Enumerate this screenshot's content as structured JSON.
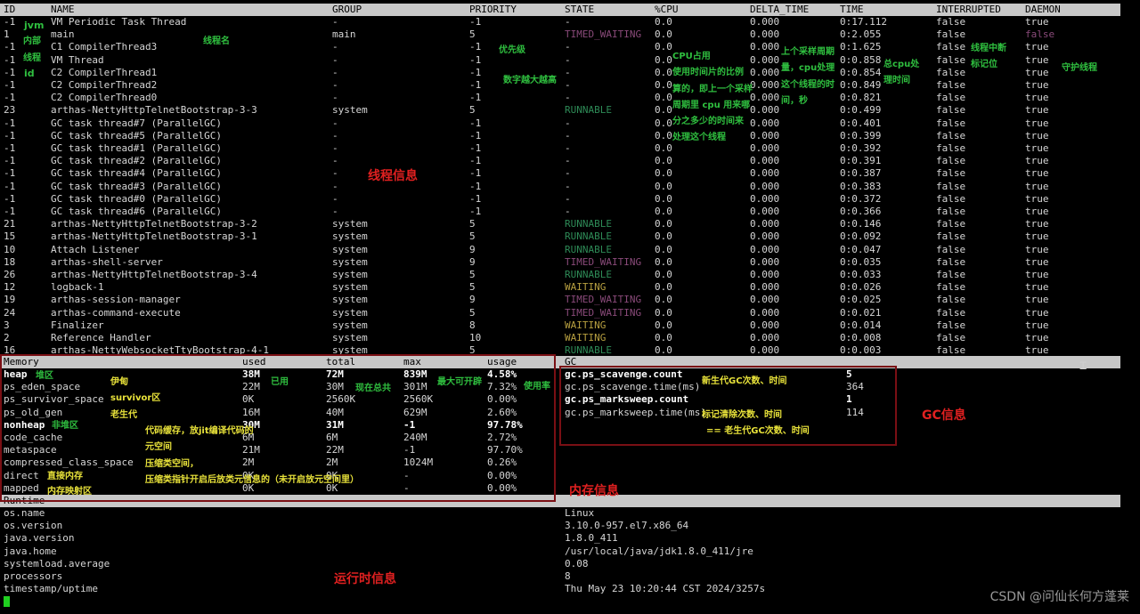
{
  "threads": {
    "headers": [
      "ID",
      "NAME",
      "GROUP",
      "PRIORITY",
      "STATE",
      "%CPU",
      "DELTA_TIME",
      "TIME",
      "INTERRUPTED",
      "DAEMON"
    ],
    "rows": [
      [
        "-1",
        "VM Periodic Task Thread",
        "-",
        "-1",
        "-",
        "0.0",
        "0.000",
        "0:17.112",
        "false",
        "true"
      ],
      [
        "1",
        "main",
        "main",
        "5",
        "TIMED_WAITING",
        "0.0",
        "0.000",
        "0:2.055",
        "false",
        "false"
      ],
      [
        "-1",
        "C1 CompilerThread3",
        "-",
        "-1",
        "-",
        "0.0",
        "0.000",
        "0:1.625",
        "false",
        "true"
      ],
      [
        "-1",
        "VM Thread",
        "-",
        "-1",
        "-",
        "0.0",
        "0.000",
        "0:0.858",
        "false",
        "true"
      ],
      [
        "-1",
        "C2 CompilerThread1",
        "-",
        "-1",
        "-",
        "0.0",
        "0.000",
        "0:0.854",
        "false",
        "true"
      ],
      [
        "-1",
        "C2 CompilerThread2",
        "-",
        "-1",
        "-",
        "0.0",
        "0.000",
        "0:0.849",
        "false",
        "true"
      ],
      [
        "-1",
        "C2 CompilerThread0",
        "-",
        "-1",
        "-",
        "0.0",
        "0.000",
        "0:0.821",
        "false",
        "true"
      ],
      [
        "23",
        "arthas-NettyHttpTelnetBootstrap-3-3",
        "system",
        "5",
        "RUNNABLE",
        "0.0",
        "0.000",
        "0:0.499",
        "false",
        "true"
      ],
      [
        "-1",
        "GC task thread#7 (ParallelGC)",
        "-",
        "-1",
        "-",
        "0.0",
        "0.000",
        "0:0.401",
        "false",
        "true"
      ],
      [
        "-1",
        "GC task thread#5 (ParallelGC)",
        "-",
        "-1",
        "-",
        "0.0",
        "0.000",
        "0:0.399",
        "false",
        "true"
      ],
      [
        "-1",
        "GC task thread#1 (ParallelGC)",
        "-",
        "-1",
        "-",
        "0.0",
        "0.000",
        "0:0.392",
        "false",
        "true"
      ],
      [
        "-1",
        "GC task thread#2 (ParallelGC)",
        "-",
        "-1",
        "-",
        "0.0",
        "0.000",
        "0:0.391",
        "false",
        "true"
      ],
      [
        "-1",
        "GC task thread#4 (ParallelGC)",
        "-",
        "-1",
        "-",
        "0.0",
        "0.000",
        "0:0.387",
        "false",
        "true"
      ],
      [
        "-1",
        "GC task thread#3 (ParallelGC)",
        "-",
        "-1",
        "-",
        "0.0",
        "0.000",
        "0:0.383",
        "false",
        "true"
      ],
      [
        "-1",
        "GC task thread#0 (ParallelGC)",
        "-",
        "-1",
        "-",
        "0.0",
        "0.000",
        "0:0.372",
        "false",
        "true"
      ],
      [
        "-1",
        "GC task thread#6 (ParallelGC)",
        "-",
        "-1",
        "-",
        "0.0",
        "0.000",
        "0:0.366",
        "false",
        "true"
      ],
      [
        "21",
        "arthas-NettyHttpTelnetBootstrap-3-2",
        "system",
        "5",
        "RUNNABLE",
        "0.0",
        "0.000",
        "0:0.146",
        "false",
        "true"
      ],
      [
        "15",
        "arthas-NettyHttpTelnetBootstrap-3-1",
        "system",
        "5",
        "RUNNABLE",
        "0.0",
        "0.000",
        "0:0.092",
        "false",
        "true"
      ],
      [
        "10",
        "Attach Listener",
        "system",
        "9",
        "RUNNABLE",
        "0.0",
        "0.000",
        "0:0.047",
        "false",
        "true"
      ],
      [
        "18",
        "arthas-shell-server",
        "system",
        "9",
        "TIMED_WAITING",
        "0.0",
        "0.000",
        "0:0.035",
        "false",
        "true"
      ],
      [
        "26",
        "arthas-NettyHttpTelnetBootstrap-3-4",
        "system",
        "5",
        "RUNNABLE",
        "0.0",
        "0.000",
        "0:0.033",
        "false",
        "true"
      ],
      [
        "12",
        "logback-1",
        "system",
        "5",
        "WAITING",
        "0.0",
        "0.000",
        "0:0.026",
        "false",
        "true"
      ],
      [
        "19",
        "arthas-session-manager",
        "system",
        "9",
        "TIMED_WAITING",
        "0.0",
        "0.000",
        "0:0.025",
        "false",
        "true"
      ],
      [
        "24",
        "arthas-command-execute",
        "system",
        "5",
        "TIMED_WAITING",
        "0.0",
        "0.000",
        "0:0.021",
        "false",
        "true"
      ],
      [
        "3",
        "Finalizer",
        "system",
        "8",
        "WAITING",
        "0.0",
        "0.000",
        "0:0.014",
        "false",
        "true"
      ],
      [
        "2",
        "Reference Handler",
        "system",
        "10",
        "WAITING",
        "0.0",
        "0.000",
        "0:0.008",
        "false",
        "true"
      ],
      [
        "16",
        "arthas-NettyWebsocketTtyBootstrap-4-1",
        "system",
        "5",
        "RUNNABLE",
        "0.0",
        "0.000",
        "0:0.003",
        "false",
        "true"
      ]
    ]
  },
  "memory": {
    "headers": [
      "Memory",
      "used",
      "total",
      "max",
      "usage"
    ],
    "rows": [
      [
        "heap",
        "38M",
        "72M",
        "839M",
        "4.58%"
      ],
      [
        "ps_eden_space",
        "22M",
        "30M",
        "301M",
        "7.32%"
      ],
      [
        "ps_survivor_space",
        "0K",
        "2560K",
        "2560K",
        "0.00%"
      ],
      [
        "ps_old_gen",
        "16M",
        "40M",
        "629M",
        "2.60%"
      ],
      [
        "nonheap",
        "30M",
        "31M",
        "-1",
        "97.78%"
      ],
      [
        "code_cache",
        "6M",
        "6M",
        "240M",
        "2.72%"
      ],
      [
        "metaspace",
        "21M",
        "22M",
        "-1",
        "97.70%"
      ],
      [
        "compressed_class_space",
        "2M",
        "2M",
        "1024M",
        "0.26%"
      ],
      [
        "direct",
        "0K",
        "0K",
        "-",
        "0.00%"
      ],
      [
        "mapped",
        "0K",
        "0K",
        "-",
        "0.00%"
      ]
    ],
    "bold_rows": [
      0,
      4
    ]
  },
  "gc": {
    "header": "GC",
    "rows": [
      [
        "gc.ps_scavenge.count",
        "5"
      ],
      [
        "gc.ps_scavenge.time(ms)",
        "364"
      ],
      [
        "gc.ps_marksweep.count",
        "1"
      ],
      [
        "gc.ps_marksweep.time(ms)",
        "114"
      ]
    ],
    "bold_rows": [
      0,
      2
    ]
  },
  "runtime": {
    "header": "Runtime",
    "rows": [
      [
        "os.name",
        "Linux"
      ],
      [
        "os.version",
        "3.10.0-957.el7.x86_64"
      ],
      [
        "java.version",
        "1.8.0_411"
      ],
      [
        "java.home",
        "/usr/local/java/jdk1.8.0_411/jre"
      ],
      [
        "systemload.average",
        "0.08"
      ],
      [
        "processors",
        "8"
      ],
      [
        "timestamp/uptime",
        "Thu May 23 10:20:44 CST 2024/3257s"
      ]
    ]
  },
  "annotations": {
    "jvm": "jvm",
    "neibu": "内部",
    "xiancheng": "线程",
    "id": "id",
    "thread_name": "线程名",
    "priority": "优先级",
    "priority_desc": "数字越大越高",
    "cpu1": "CPU占用",
    "cpu2": "使用时间片的比例",
    "cpu3": "算的，即上一个采样",
    "cpu4": "周期里 cpu 用来哪",
    "cpu5": "分之多少的时间来",
    "cpu6": "处理这个线程",
    "delta1": "上个采样周期",
    "delta2": "量，cpu处理",
    "delta3": "这个线程的时",
    "delta4": "间，秒",
    "total_cpu1": "总cpu处",
    "total_cpu2": "理时间",
    "interrupt1": "线程中断",
    "interrupt2": "标记位",
    "daemon": "守护线程",
    "thread_info": "线程信息",
    "heap": "堆区",
    "eden": "伊甸",
    "survivor": "survivor区",
    "old": "老生代",
    "nonheap": "非堆区",
    "used": "已用",
    "total": "现在总共",
    "max": "最大可开辟",
    "usage": "使用率",
    "code_cache1": "代码缓存，放jit编译代码的",
    "code_cache2": "元空间",
    "compressed": "压缩类空间，",
    "compressed2": "压缩类指针开启后放类元信息的（未开启放元空间里）",
    "direct": "直接内存",
    "mapped": "内存映射区",
    "memory_info": "内存信息",
    "gc_young": "新生代GC次数、时间",
    "gc_mark": "标记清除次数、时间",
    "gc_old": "== 老生代GC次数、时间",
    "gc_info": "GC信息",
    "runtime_info": "运行时信息"
  },
  "watermark": "CSDN @问仙长何方蓬莱"
}
